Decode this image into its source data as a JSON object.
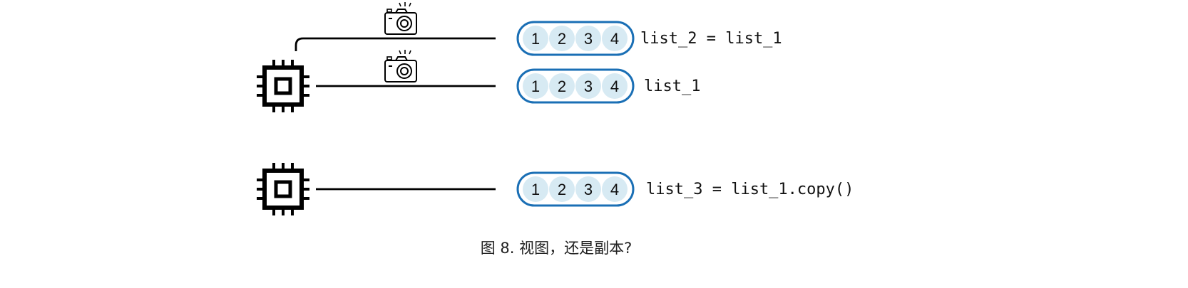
{
  "rows": [
    {
      "values": [
        "1",
        "2",
        "3",
        "4"
      ],
      "label": "list_2 = list_1"
    },
    {
      "values": [
        "1",
        "2",
        "3",
        "4"
      ],
      "label": "list_1"
    },
    {
      "values": [
        "1",
        "2",
        "3",
        "4"
      ],
      "label": "list_3 = list_1.copy()"
    }
  ],
  "caption": "图 8. 视图，还是副本?",
  "icons": {
    "processor": "cpu-chip-icon",
    "camera": "camera-icon"
  },
  "colors": {
    "pill_border": "#1a6fb5",
    "cell_fill": "#d7eaf3"
  }
}
